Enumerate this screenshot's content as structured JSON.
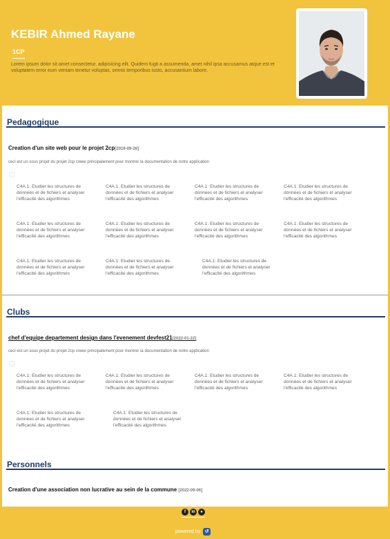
{
  "profile": {
    "name": "KEBIR Ahmed Rayane",
    "level": "1CP",
    "bio": "Lorem ipsum dolor sit amet consectetur, adipisicing elit. Quidem fugit a assumenda, amet nihil ipsa accusamus atque est et voluptatem error eum veniam tenetur voluptas, omnis temporibus iusto, accusantium labore."
  },
  "sections": [
    {
      "title": "Pedagogique",
      "items": [
        {
          "title": "Creation d'un site web pour le projet 2cp",
          "date": "[2019-09-26]",
          "description": "ceci est un sous projet du projet 2cp creee principalement pour montrer la documentation de notre application",
          "skills": [
            "C4A.1: Etudier les structures de données et de fichiers et analyser l'efficacité des algorithmes",
            "C4A.1: Etudier les structures de données et de fichiers et analyser l'efficacité des algorithmes",
            "C4A.1: Etudier les structures de données et de fichiers et analyser l'efficacité des algorithmes",
            "C4A.1: Etudier les structures de données et de fichiers et analyser l'efficacité des algorithmes",
            "C4A.1: Etudier les structures de données et de fichiers et analyser l'efficacité des algorithmes",
            "C4A.1: Etudier les structures de données et de fichiers et analyser l'efficacité des algorithmes",
            "C4A.1: Etudier les structures de données et de fichiers et analyser l'efficacité des algorithmes",
            "C4A.1: Etudier les structures de données et de fichiers et analyser l'efficacité des algorithmes",
            "C4A.1: Etudier les structures de données et de fichiers et analyser l'efficacité des algorithmes",
            "C4A.1: Etudier les structures de données et de fichiers et analyser l'efficacité des algorithmes",
            "C4A.1: Etudier les structures de données et de fichiers et analyser l'efficacité des algorithmes"
          ]
        }
      ]
    },
    {
      "title": "Clubs",
      "items": [
        {
          "title": "chef d'equipe departement design dans l'evenement devfest21",
          "date": "[2022-01-22]",
          "description": "ceci est un sous projet du projet 2cp creee principalement pour montrer la documentation de notre application",
          "skills": [
            "C4A.1: Etudier les structures de données et de fichiers et analyser l'efficacité des algorithmes",
            "C4A.1: Etudier les structures de données et de fichiers et analyser l'efficacité des algorithmes",
            "C4A.1: Etudier les structures de données et de fichiers et analyser l'efficacité des algorithmes",
            "C4A.1: Etudier les structures de données et de fichiers et analyser l'efficacité des algorithmes",
            "C4A.1: Etudier les structures de données et de fichiers et analyser l'efficacité des algorithmes",
            "C4A.1: Etudier les structures de données et de fichiers et analyser l'efficacité des algorithmes"
          ]
        }
      ]
    },
    {
      "title": "Personnels",
      "items": [
        {
          "title": "Creation d'une association non lucrative au sein de la commune",
          "date": "[2022-09-06]"
        }
      ]
    }
  ],
  "footer": {
    "social_icons": [
      "facebook-icon",
      "linkedin-icon",
      "github-icon"
    ],
    "powered_by": "powered by"
  },
  "colors": {
    "accent": "#f2c43d",
    "heading": "#1f3b66"
  }
}
